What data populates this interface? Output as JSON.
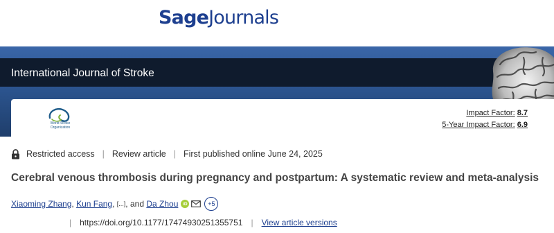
{
  "brand": {
    "part1": "Sage",
    "part2": "Journals"
  },
  "journal": {
    "title": "International Journal of Stroke"
  },
  "society_logo": {
    "lines": [
      "World Stroke",
      "Organization"
    ]
  },
  "metrics": [
    {
      "label": "Impact Factor:",
      "value": "8.7"
    },
    {
      "label": "5-Year Impact Factor:",
      "value": "6.9"
    }
  ],
  "meta": {
    "access": "Restricted access",
    "type": "Review article",
    "published": "First published online June 24, 2025"
  },
  "article": {
    "title": "Cerebral venous thrombosis during pregnancy and postpartum: A systematic review and meta-analysis"
  },
  "authors": {
    "first": "Xiaoming Zhang",
    "second": "Kun Fang",
    "ellipsis": "[...]",
    "and": "and",
    "last": "Da Zhou",
    "orcid_label": "iD",
    "more": "+5"
  },
  "doi": {
    "url": "https://doi.org/10.1177/17474930251355751",
    "versions_label": "View article versions"
  },
  "icons": {
    "lock": "lock-icon",
    "orcid": "orcid-icon",
    "mail": "mail-icon"
  },
  "colors": {
    "brand_blue": "#1d3f8f",
    "banner_dark": "#0f1b2d",
    "banner_blue": "#2c5590",
    "orcid_green": "#a6ce39"
  }
}
